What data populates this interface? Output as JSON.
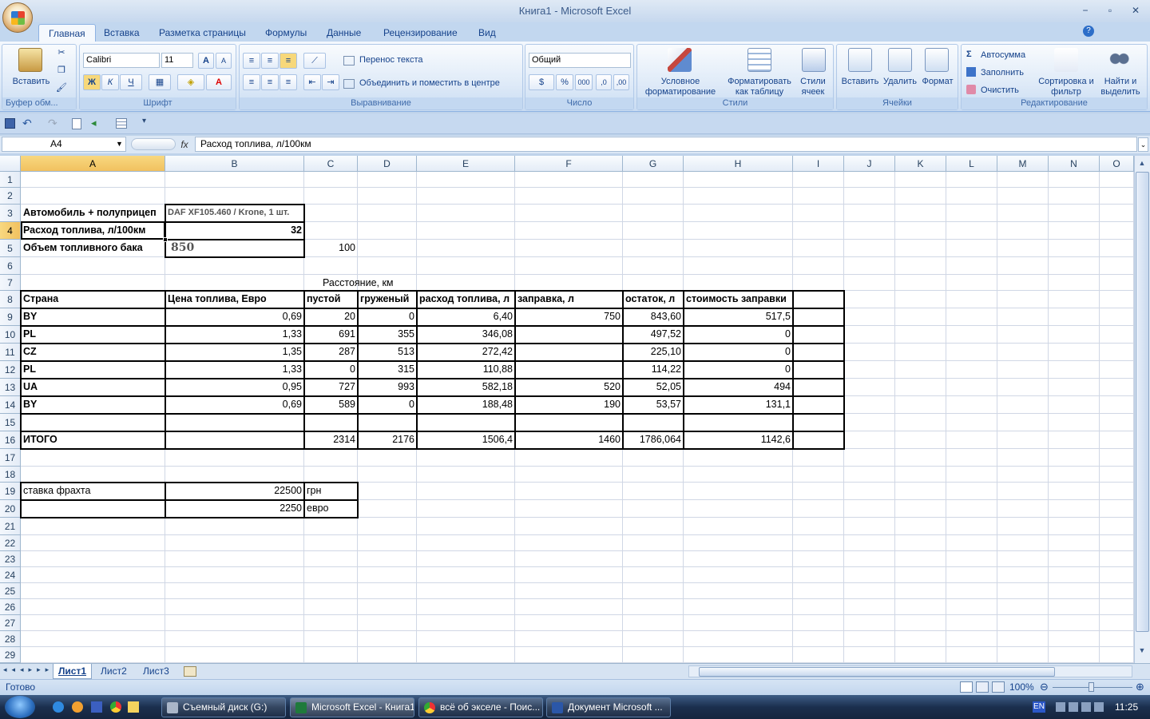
{
  "window": {
    "title": "Книга1 - Microsoft Excel",
    "minimize": "−",
    "restore": "▫",
    "close": "✕"
  },
  "tabs": [
    "Главная",
    "Вставка",
    "Разметка страницы",
    "Формулы",
    "Данные",
    "Рецензирование",
    "Вид"
  ],
  "ribbon": {
    "clipboard": {
      "label": "Буфер обм...",
      "paste": "Вставить"
    },
    "font": {
      "label": "Шрифт",
      "name": "Calibri",
      "size": "11",
      "bold": "Ж",
      "italic": "К",
      "underline": "Ч",
      "grow": "A",
      "shrink": "A",
      "color": "A"
    },
    "alignment": {
      "label": "Выравнивание",
      "wrap": "Перенос текста",
      "merge": "Объединить и поместить в центре"
    },
    "number": {
      "label": "Число",
      "format": "Общий",
      "percent": "%",
      "thousands": "000"
    },
    "styles": {
      "label": "Стили",
      "conditional": "Условное форматирование",
      "table": "Форматировать как таблицу",
      "cell": "Стили ячеек"
    },
    "cells": {
      "label": "Ячейки",
      "insert": "Вставить",
      "delete": "Удалить",
      "format": "Формат"
    },
    "editing": {
      "label": "Редактирование",
      "autosum": "Автосумма",
      "fill": "Заполнить",
      "clear": "Очистить",
      "sort": "Сортировка и фильтр",
      "find": "Найти и выделить"
    }
  },
  "formula_bar": {
    "name_box": "A4",
    "fx": "fx",
    "content": "Расход топлива, л/100км"
  },
  "columns": [
    "A",
    "B",
    "C",
    "D",
    "E",
    "F",
    "G",
    "H",
    "I",
    "J",
    "K",
    "L",
    "M",
    "N",
    "O"
  ],
  "rows": [
    "1",
    "2",
    "3",
    "4",
    "5",
    "6",
    "7",
    "8",
    "9",
    "10",
    "11",
    "12",
    "13",
    "14",
    "15",
    "16",
    "17",
    "18",
    "19",
    "20",
    "21",
    "22",
    "23",
    "24",
    "25",
    "26",
    "27",
    "28",
    "29"
  ],
  "cells": {
    "A3": "Автомобиль + полуприцеп",
    "B3": "DAF XF105.460 / Krone, 1 шт.",
    "A4": "Расход топлива, л/100км",
    "B4": "32",
    "A5": "Объем топливного бака",
    "B5": "850",
    "C5": "100",
    "C7": "Расстояние, км",
    "A8": "Страна",
    "B8": "Цена топлива, Евро",
    "C8": "пустой",
    "D8": "груженый",
    "E8": "расход топлива, л",
    "F8": "заправка, л",
    "G8": "остаток, л",
    "H8": "стоимость заправки",
    "A9": "BY",
    "B9": "0,69",
    "C9": "20",
    "D9": "0",
    "E9": "6,40",
    "F9": "750",
    "G9": "843,60",
    "H9": "517,5",
    "A10": "PL",
    "B10": "1,33",
    "C10": "691",
    "D10": "355",
    "E10": "346,08",
    "G10": "497,52",
    "H10": "0",
    "A11": "CZ",
    "B11": "1,35",
    "C11": "287",
    "D11": "513",
    "E11": "272,42",
    "G11": "225,10",
    "H11": "0",
    "A12": "PL",
    "B12": "1,33",
    "C12": "0",
    "D12": "315",
    "E12": "110,88",
    "G12": "114,22",
    "H12": "0",
    "A13": "UA",
    "B13": "0,95",
    "C13": "727",
    "D13": "993",
    "E13": "582,18",
    "F13": "520",
    "G13": "52,05",
    "H13": "494",
    "A14": "BY",
    "B14": "0,69",
    "C14": "589",
    "D14": "0",
    "E14": "188,48",
    "F14": "190",
    "G14": "53,57",
    "H14": "131,1",
    "A16": "ИТОГО",
    "C16": "2314",
    "D16": "2176",
    "E16": "1506,4",
    "F16": "1460",
    "G16": "1786,064",
    "H16": "1142,6",
    "A19": "ставка фрахта",
    "B19": "22500",
    "C19": "грн",
    "B20": "2250",
    "C20": "евро"
  },
  "sheets": [
    "Лист1",
    "Лист2",
    "Лист3"
  ],
  "status": {
    "ready": "Готово",
    "zoom": "100%"
  },
  "taskbar": {
    "items": [
      "Съемный диск (G:)",
      "Microsoft Excel - Книга1",
      "всё об экселе - Поис...",
      "Документ Microsoft ..."
    ],
    "lang": "EN",
    "clock": "11:25"
  }
}
